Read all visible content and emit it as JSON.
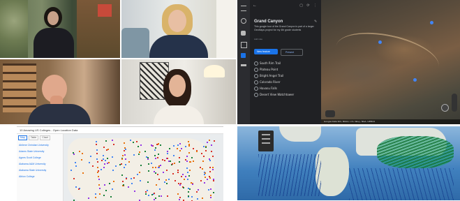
{
  "earth": {
    "title": "Grand Canyon",
    "description": "This google tour of the Grand Canyon is part of a larger GeoMaps project for my 4th grade students",
    "meta": "Add note",
    "present_label": "Present",
    "add_label": "New feature",
    "items": [
      "South Rim Trail",
      "Plateau Point",
      "Bright Angel Trail",
      "Colorado River",
      "Havasu Falls",
      "Desert View Watchtower"
    ],
    "bottom_bar": "Google   Data SIO, NOAA, U.S. Navy, NGA, GEBCO"
  },
  "collection": {
    "title": "10 Amazing US Colleges - Open Location Data",
    "tabs": [
      "Map",
      "Table",
      "Chart"
    ],
    "list": [
      "Abilene Christian University",
      "Adams State University",
      "Agnes Scott College",
      "Alabama A&M University",
      "Alabama State University",
      "Albion College"
    ]
  },
  "colors": {
    "accent": "#1a73e8",
    "red": "#d93025",
    "orange": "#e8710a",
    "blue": "#4285f4",
    "green": "#188038",
    "purple": "#9334e6"
  }
}
